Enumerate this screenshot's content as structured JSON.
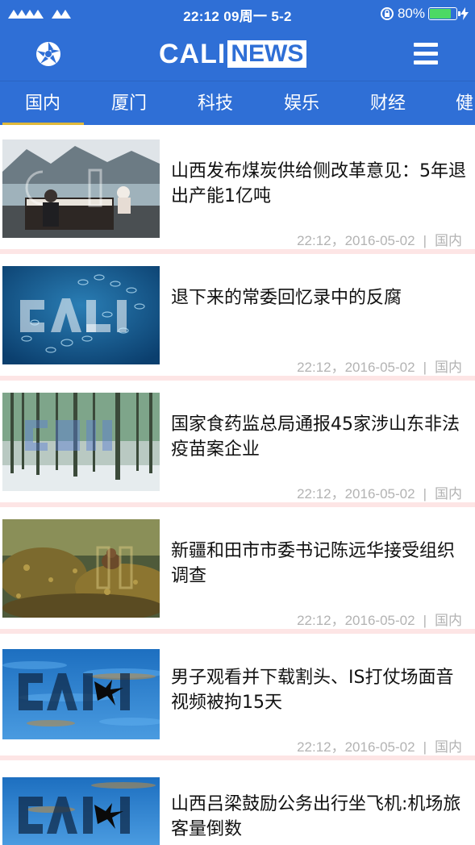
{
  "status_bar": {
    "time": "22:12 09周一 5-2",
    "battery": "80%",
    "battery_level": 0.8
  },
  "header": {
    "logo_left": "CALI",
    "logo_right": "NEWS",
    "left_icon": "shutter-logo-icon",
    "right_icon": "hamburger-menu-icon"
  },
  "tabs": [
    {
      "label": "国内",
      "active": true
    },
    {
      "label": "厦门"
    },
    {
      "label": "科技"
    },
    {
      "label": "娱乐"
    },
    {
      "label": "财经"
    },
    {
      "label": "健"
    }
  ],
  "colors": {
    "primary": "#2f6fd6",
    "tab_underline": "#e0b93a",
    "separator": "#fde5e5",
    "meta_text": "#b3b3b3"
  },
  "news": [
    {
      "title": "山西发布煤炭供给侧改革意见：5年退出产能1亿吨",
      "time": "22:12，2016-05-02",
      "category": "国内",
      "image": "piano-lake-thumbnail"
    },
    {
      "title": "退下来的常委回忆录中的反腐",
      "time": "22:12，2016-05-02",
      "category": "国内",
      "image": "underwater-bubbles-thumbnail"
    },
    {
      "title": "国家食药监总局通报45家涉山东非法疫苗案企业",
      "time": "22:12，2016-05-02",
      "category": "国内",
      "image": "snowy-forest-thumbnail"
    },
    {
      "title": "新疆和田市市委书记陈远华接受组织调查",
      "time": "22:12，2016-05-02",
      "category": "国内",
      "image": "bear-rocks-thumbnail"
    },
    {
      "title": "男子观看并下载割头、IS打仗场面音视频被拘15天",
      "time": "22:12，2016-05-02",
      "category": "国内",
      "image": "swallow-water-thumbnail"
    },
    {
      "title": "山西吕梁鼓励公务出行坐飞机:机场旅客量倒数",
      "time": "",
      "category": "",
      "image": "swallow-water-thumbnail"
    }
  ]
}
